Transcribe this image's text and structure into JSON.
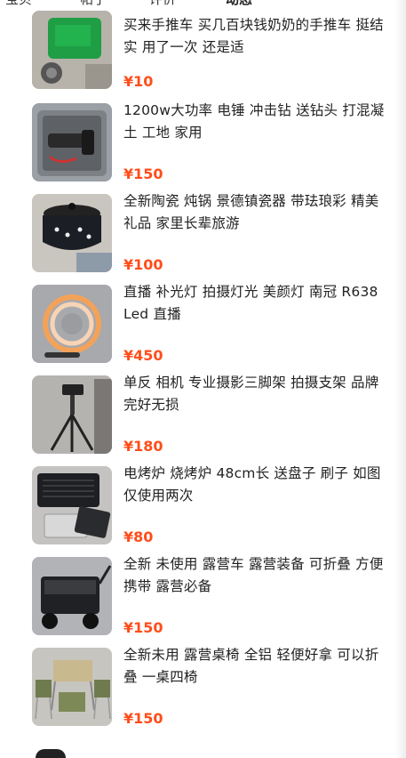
{
  "tabs": [
    {
      "label": "宝贝"
    },
    {
      "label": "帖子"
    },
    {
      "label": "评价"
    },
    {
      "label": "动态"
    }
  ],
  "items": [
    {
      "title": "买来手推车 买几百块钱奶奶的手推车 挺结实 用了一次 还是适",
      "price": "¥10",
      "thumb": "green-cart"
    },
    {
      "title": "1200w大功率 电锤 冲击钻 送钻头 打混凝土 工地 家用",
      "price": "¥150",
      "thumb": "hammer-drill-case"
    },
    {
      "title": "全新陶瓷 炖锅 景德镇瓷器 带珐琅彩 精美礼品 家里长辈旅游",
      "price": "¥100",
      "thumb": "ceramic-pot"
    },
    {
      "title": "直播 补光灯 拍摄灯光 美颜灯 南冠 R638 Led 直播",
      "price": "¥450",
      "thumb": "ring-light"
    },
    {
      "title": "单反 相机 专业摄影三脚架 拍摄支架 品牌 完好无损",
      "price": "¥180",
      "thumb": "tripod"
    },
    {
      "title": "电烤炉 烧烤炉 48cm长 送盘子 刷子 如图 仅使用两次",
      "price": "¥80",
      "thumb": "electric-grill"
    },
    {
      "title": "全新 未使用 露营车 露营装备 可折叠 方便携带 露营必备",
      "price": "¥150",
      "thumb": "camping-wagon"
    },
    {
      "title": "全新未用 露营桌椅 全铝 轻便好拿 可以折叠 一桌四椅",
      "price": "¥150",
      "thumb": "camping-table-chairs"
    }
  ],
  "colors": {
    "price": "#ff4d1a",
    "tab_indicator": "#ffe033"
  }
}
